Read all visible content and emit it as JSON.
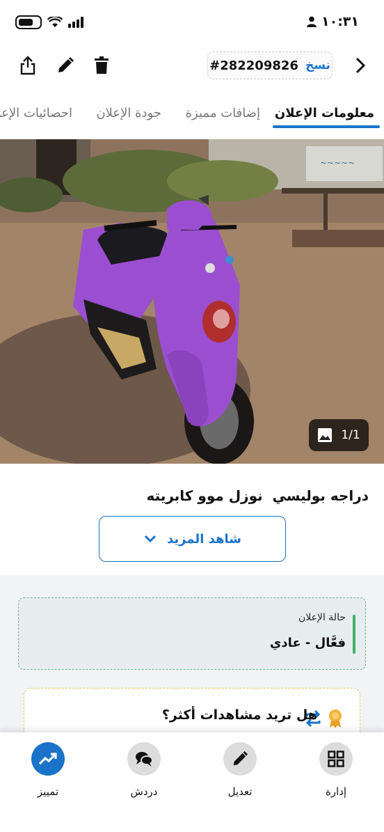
{
  "status_bar": {
    "time": "١٠:٣١"
  },
  "toolbar": {
    "copy_label": "نسخ",
    "ad_id": "#282209826"
  },
  "tabs": [
    {
      "label": "معلومات الإعلان"
    },
    {
      "label": "إضافات مميزة"
    },
    {
      "label": "جودة الإعلان"
    },
    {
      "label": "احصائيات الإعلان"
    }
  ],
  "photo": {
    "counter": "1/1"
  },
  "listing": {
    "title": "دراجه بوليسي  نوزل موو كابريته",
    "more_label": "شاهد المزيد"
  },
  "ad_status": {
    "label": "حالة الإعلان",
    "value": "فعَّال - عادي"
  },
  "promo": {
    "title": "هل تريد مشاهدات أكثر؟"
  },
  "bottom_nav": [
    {
      "label": "تمييز",
      "icon": "trending-up-icon"
    },
    {
      "label": "دردش",
      "icon": "chat-icon"
    },
    {
      "label": "تعديل",
      "icon": "pencil-icon"
    },
    {
      "label": "إدارة",
      "icon": "grid-icon"
    }
  ],
  "colors": {
    "accent": "#1a73c8",
    "active_status": "#41b36a",
    "scooter": "#9b4fd0"
  }
}
